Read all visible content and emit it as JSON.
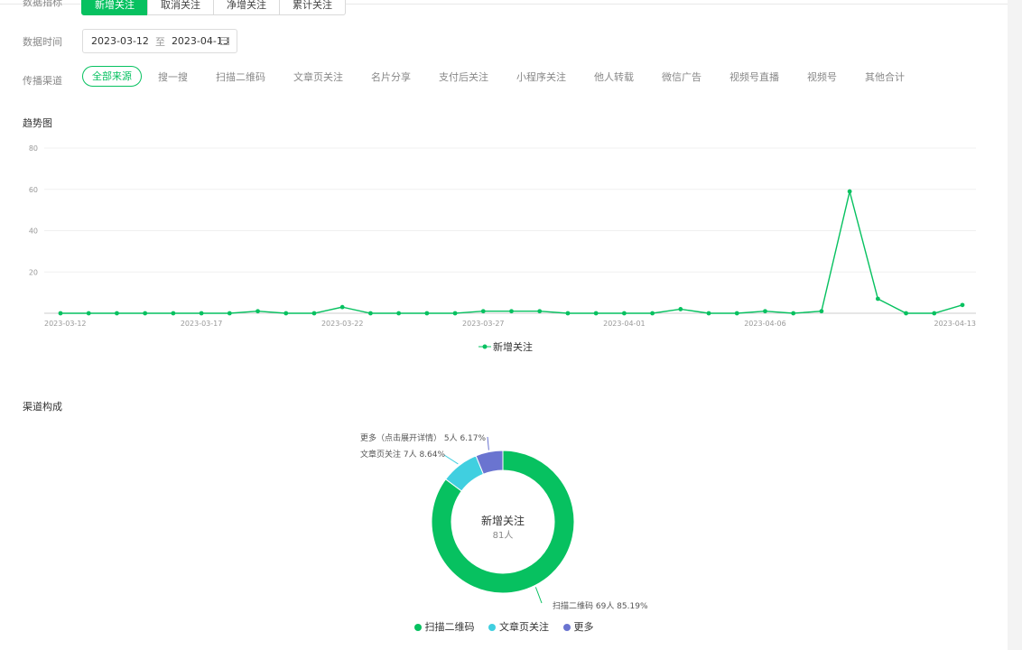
{
  "filters": {
    "metric_label": "数据指标",
    "metric_tabs": [
      "新增关注",
      "取消关注",
      "净增关注",
      "累计关注"
    ],
    "date_label": "数据时间",
    "date_start": "2023-03-12",
    "date_sep": "至",
    "date_end": "2023-04-13",
    "channel_label": "传播渠道",
    "channels": [
      "全部来源",
      "搜一搜",
      "扫描二维码",
      "文章页关注",
      "名片分享",
      "支付后关注",
      "小程序关注",
      "他人转载",
      "微信广告",
      "视频号直播",
      "视频号",
      "其他合计"
    ]
  },
  "trend": {
    "title": "趋势图",
    "legend": "新增关注"
  },
  "channel": {
    "title": "渠道构成",
    "center_title": "新增关注",
    "center_sub": "81人",
    "labels": [
      "更多（点击展开详情） 5人 6.17%",
      "文章页关注 7人 8.64%",
      "扫描二维码 69人 85.19%"
    ],
    "legend": [
      "扫描二维码",
      "文章页关注",
      "更多"
    ]
  },
  "colors": {
    "accent": "#07c160",
    "teal": "#40cfe0",
    "purple": "#6a74d0"
  },
  "chart_data": [
    {
      "type": "line",
      "title": "趋势图",
      "x": [
        "2023-03-12",
        "2023-03-13",
        "2023-03-14",
        "2023-03-15",
        "2023-03-16",
        "2023-03-17",
        "2023-03-18",
        "2023-03-19",
        "2023-03-20",
        "2023-03-21",
        "2023-03-22",
        "2023-03-23",
        "2023-03-24",
        "2023-03-25",
        "2023-03-26",
        "2023-03-27",
        "2023-03-28",
        "2023-03-29",
        "2023-03-30",
        "2023-03-31",
        "2023-04-01",
        "2023-04-02",
        "2023-04-03",
        "2023-04-04",
        "2023-04-05",
        "2023-04-06",
        "2023-04-07",
        "2023-04-08",
        "2023-04-09",
        "2023-04-10",
        "2023-04-11",
        "2023-04-12",
        "2023-04-13"
      ],
      "x_ticks": [
        "2023-03-12",
        "2023-03-17",
        "2023-03-22",
        "2023-03-27",
        "2023-04-01",
        "2023-04-06",
        "2023-04-13"
      ],
      "series": [
        {
          "name": "新增关注",
          "values": [
            0,
            0,
            0,
            0,
            0,
            0,
            0,
            1,
            0,
            0,
            3,
            0,
            0,
            0,
            0,
            1,
            1,
            1,
            0,
            0,
            0,
            0,
            2,
            0,
            0,
            1,
            0,
            1,
            59,
            7,
            0,
            0,
            4
          ]
        }
      ],
      "y_ticks": [
        20,
        40,
        60,
        80
      ],
      "ylim": [
        0,
        80
      ],
      "grid": true,
      "legend_position": "bottom"
    },
    {
      "type": "pie",
      "title": "渠道构成",
      "labels": [
        "扫描二维码",
        "文章页关注",
        "更多"
      ],
      "values": [
        69,
        7,
        5
      ],
      "percents": [
        85.19,
        8.64,
        6.17
      ],
      "total": 81
    }
  ]
}
